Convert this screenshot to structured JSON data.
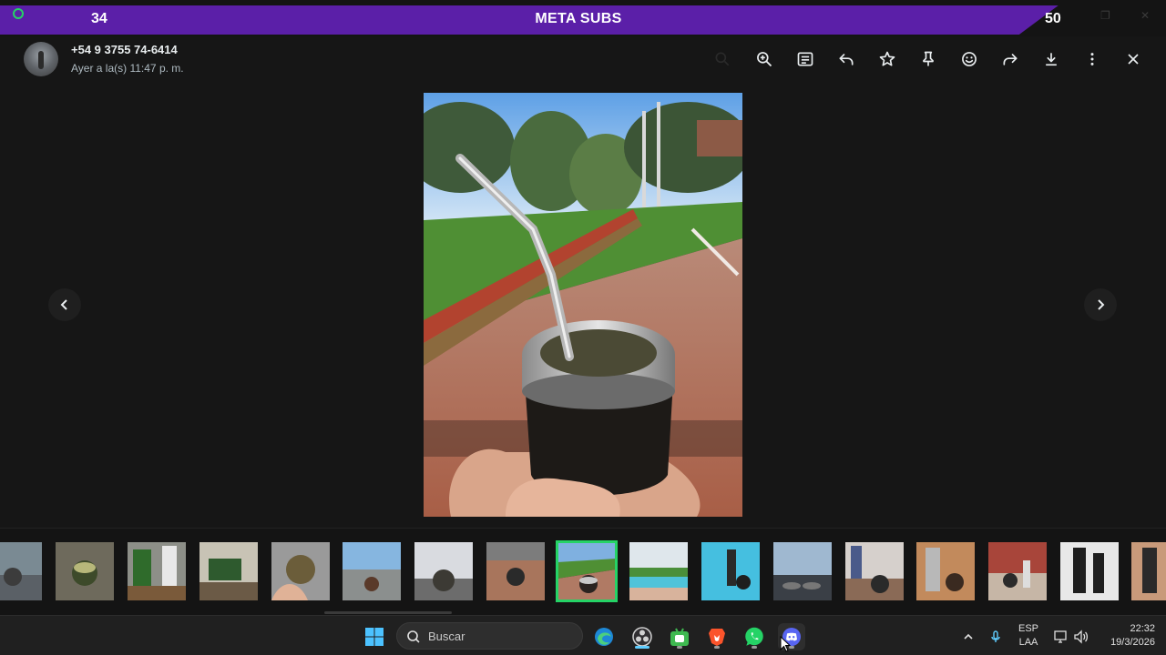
{
  "banner": {
    "title": "META SUBS",
    "start_value": "34",
    "end_value": "50",
    "progress_fraction": 0.94,
    "fill_color": "#5b1fa8"
  },
  "header": {
    "contact_name": "+54 9 3755 74-6414",
    "timestamp": "Ayer a la(s) 11:47 p. m."
  },
  "toolbar": {
    "icons": [
      "zoom-in-icon",
      "caption-icon",
      "reply-icon",
      "star-icon",
      "pin-icon",
      "emoji-icon",
      "forward-icon",
      "download-icon",
      "more-icon",
      "close-icon"
    ]
  },
  "viewer": {
    "prev_icon": "chevron-left-icon",
    "next_icon": "chevron-right-icon"
  },
  "thumbnails": {
    "count": 17,
    "selected_index": 8,
    "accent_color": "#25d366"
  },
  "taskbar": {
    "search_placeholder": "Buscar",
    "apps": [
      "windows-start",
      "search",
      "edge",
      "obs",
      "android",
      "brave",
      "whatsapp",
      "discord"
    ],
    "language_line1": "ESP",
    "language_line2": "LAA",
    "clock_time": "22:32",
    "clock_date": "19/3/2026"
  }
}
